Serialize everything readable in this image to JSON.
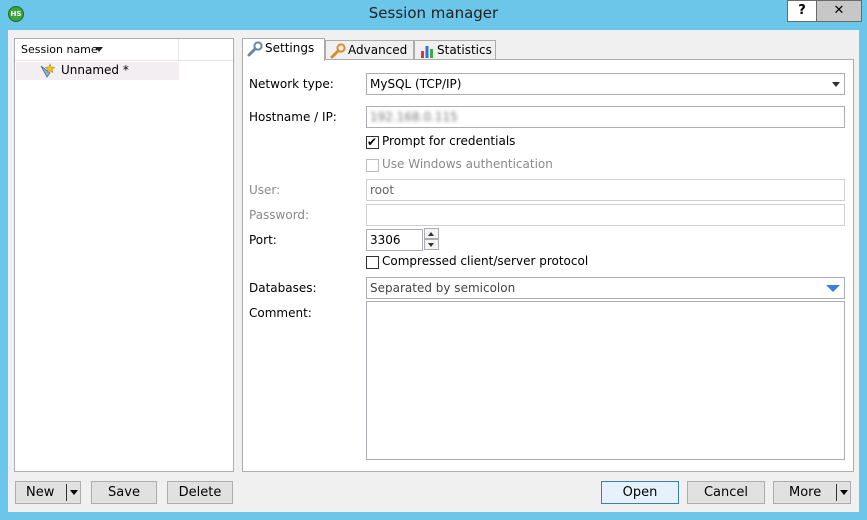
{
  "window": {
    "title": "Session manager",
    "help_label": "?",
    "close_label": "✕",
    "app_icon_text": "HS"
  },
  "tree": {
    "header": "Session name",
    "items": [
      {
        "label": "Unnamed *"
      }
    ]
  },
  "tabs": [
    {
      "label": "Settings",
      "icon": "wrench-icon",
      "active": true
    },
    {
      "label": "Advanced",
      "icon": "wrench-orange-icon",
      "active": false
    },
    {
      "label": "Statistics",
      "icon": "bar-chart-icon",
      "active": false
    }
  ],
  "settings": {
    "network_type": {
      "label": "Network type:",
      "value": "MySQL (TCP/IP)"
    },
    "hostname": {
      "label": "Hostname / IP:",
      "value": "192.168.0.115"
    },
    "prompt_credentials": {
      "label": "Prompt for credentials",
      "checked": true
    },
    "windows_auth": {
      "label": "Use Windows authentication",
      "checked": false,
      "disabled": true
    },
    "user": {
      "label": "User:",
      "value": "root"
    },
    "password": {
      "label": "Password:",
      "value": ""
    },
    "port": {
      "label": "Port:",
      "value": "3306"
    },
    "compressed": {
      "label": "Compressed client/server protocol",
      "checked": false
    },
    "databases": {
      "label": "Databases:",
      "placeholder": "Separated by semicolon"
    },
    "comment": {
      "label": "Comment:",
      "value": ""
    }
  },
  "buttons": {
    "new": "New",
    "save": "Save",
    "delete": "Delete",
    "open": "Open",
    "cancel": "Cancel",
    "more": "More"
  }
}
